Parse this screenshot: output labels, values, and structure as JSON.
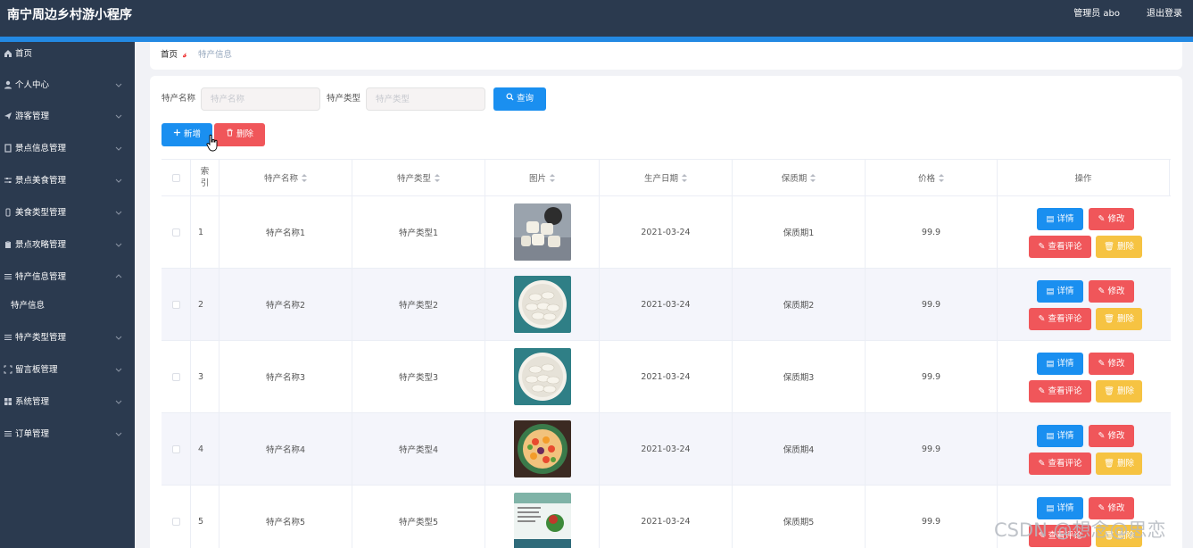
{
  "header": {
    "title": "南宁周边乡村游小程序",
    "user_label": "管理员 abo",
    "logout_label": "退出登录"
  },
  "sidebar": {
    "items": [
      {
        "label": "首页",
        "icon": "home-icon"
      },
      {
        "label": "个人中心",
        "icon": "user-icon"
      },
      {
        "label": "游客管理",
        "icon": "send-icon"
      },
      {
        "label": "景点信息管理",
        "icon": "document-icon"
      },
      {
        "label": "景点美食管理",
        "icon": "sliders-icon"
      },
      {
        "label": "美食类型管理",
        "icon": "mobile-icon"
      },
      {
        "label": "景点攻略管理",
        "icon": "clipboard-icon"
      },
      {
        "label": "特产信息管理",
        "icon": "list-icon"
      },
      {
        "label": "特产信息",
        "icon": ""
      },
      {
        "label": "特产类型管理",
        "icon": "list-icon"
      },
      {
        "label": "留言板管理",
        "icon": "frame-icon"
      },
      {
        "label": "系统管理",
        "icon": "grid-icon"
      },
      {
        "label": "订单管理",
        "icon": "list-icon"
      }
    ]
  },
  "breadcrumb": {
    "home": "首页",
    "separator": "𝓈",
    "current": "特产信息"
  },
  "filters": {
    "name_label": "特产名称",
    "name_placeholder": "特产名称",
    "type_label": "特产类型",
    "type_placeholder": "特产类型",
    "search_label": "查询"
  },
  "toolbar": {
    "add_label": "新增",
    "delete_label": "删除"
  },
  "table": {
    "columns": [
      "索引",
      "特产名称",
      "特产类型",
      "图片",
      "生产日期",
      "保质期",
      "价格",
      "操作"
    ],
    "rows": [
      {
        "index": "1",
        "name": "特产名称1",
        "type": "特产类型1",
        "image": "steamed-buns",
        "date": "2021-03-24",
        "shelf": "保质期1",
        "price": "99.9"
      },
      {
        "index": "2",
        "name": "特产名称2",
        "type": "特产类型2",
        "image": "dumplings",
        "date": "2021-03-24",
        "shelf": "保质期2",
        "price": "99.9"
      },
      {
        "index": "3",
        "name": "特产名称3",
        "type": "特产类型3",
        "image": "dumplings",
        "date": "2021-03-24",
        "shelf": "保质期3",
        "price": "99.9"
      },
      {
        "index": "4",
        "name": "特产名称4",
        "type": "特产类型4",
        "image": "fruit-bowl",
        "date": "2021-03-24",
        "shelf": "保质期4",
        "price": "99.9"
      },
      {
        "index": "5",
        "name": "特产名称5",
        "type": "特产类型5",
        "image": "poster",
        "date": "2021-03-24",
        "shelf": "保质期5",
        "price": "99.9"
      }
    ],
    "actions": {
      "detail": "详情",
      "edit": "修改",
      "comment": "查看评论",
      "delete": "删除"
    }
  },
  "watermark": "CSDN @想念@思恋",
  "colors": {
    "topbar": "#2b3a4f",
    "accent": "#2389e3",
    "primary": "#1a8ff0",
    "danger": "#f0565a",
    "warning": "#f6c342"
  }
}
